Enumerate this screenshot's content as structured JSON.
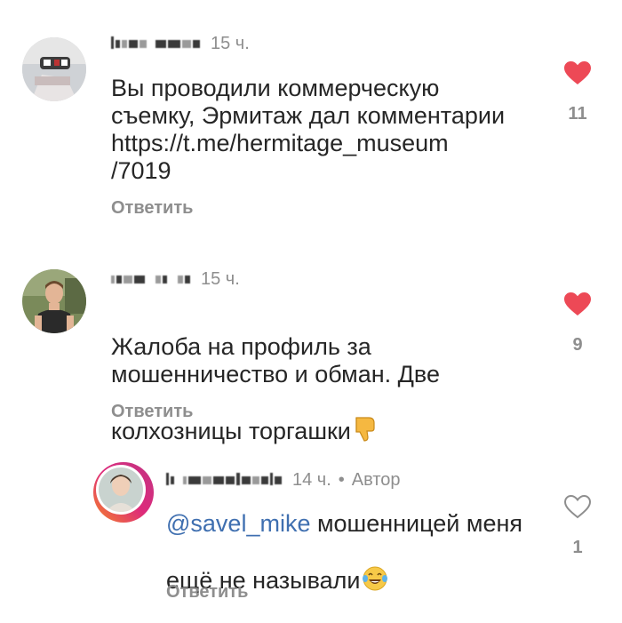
{
  "comments": [
    {
      "time": "15 ч.",
      "text": "Вы проводили коммерческую\nсъемку, Эрмитаж дал комментарии\nhttps://t.me/hermitage_museum\n/7019",
      "reply_label": "Ответить",
      "like_count": "11",
      "liked": true,
      "icons": {
        "like": "heart-filled-icon"
      }
    },
    {
      "time": "15 ч.",
      "text": "Жалоба на профиль за\nмошенничество и обман. Две\nколхозницы торгашки",
      "emoji": "thumbs-down-emoji",
      "reply_label": "Ответить",
      "like_count": "9",
      "liked": true,
      "icons": {
        "like": "heart-filled-icon"
      }
    },
    {
      "time": "14 ч.",
      "separator": "•",
      "author_badge": "Автор",
      "mention": "@savel_mike",
      "text": " мошенницей меня\nещё не называли",
      "emoji": "laughing-tears-emoji",
      "reply_label": "Ответить",
      "like_count": "1",
      "liked": false,
      "icons": {
        "like": "heart-outline-icon"
      }
    }
  ],
  "colors": {
    "text": "#262626",
    "secondary": "#8e8e8e",
    "heart": "#ed4956",
    "mention": "#3f6fb0",
    "story_ring_start": "#f58529",
    "story_ring_end": "#c13584"
  }
}
